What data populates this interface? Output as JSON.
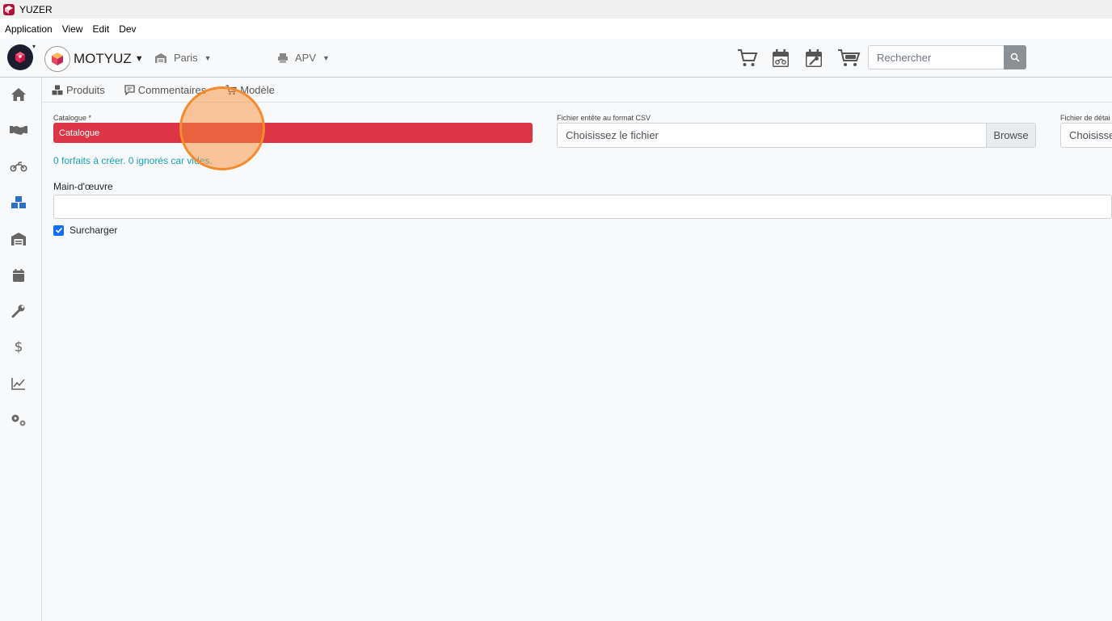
{
  "window": {
    "title": "YUZER"
  },
  "menu": {
    "items": [
      "Application",
      "View",
      "Edit",
      "Dev"
    ]
  },
  "header": {
    "org_name": "MOTYUZ",
    "site": "Paris",
    "department": "APV",
    "search_placeholder": "Rechercher"
  },
  "tabs": [
    {
      "label": "Produits"
    },
    {
      "label": "Commentaires"
    },
    {
      "label": "Modèle"
    }
  ],
  "form": {
    "catalogue_label": "Catalogue *",
    "catalogue_value": "Catalogue",
    "header_file_label": "Fichier entête au format CSV",
    "header_file_placeholder": "Choisissez le fichier",
    "browse_label": "Browse",
    "detail_file_label": "Fichier de détai",
    "detail_file_placeholder": "Choisissez",
    "info_text": "0 forfaits à créer. 0 ignorés car vides.",
    "labour_label": "Main-d'œuvre",
    "labour_value": "",
    "overwrite_label": "Surcharger",
    "overwrite_checked": true
  },
  "colors": {
    "danger": "#dc3545",
    "info": "#17a2b8",
    "primary": "#0d6efd",
    "click_indicator": "#f58a2f"
  },
  "icons": {
    "sidebar": [
      "home-icon",
      "handshake-icon",
      "motorcycle-icon",
      "cubes-icon",
      "warehouse-icon",
      "calendar-icon",
      "wrench-icon",
      "dollar-icon",
      "chart-line-icon",
      "gears-icon"
    ],
    "header": [
      "cart-icon",
      "calendar-moto-icon",
      "calendar-wrench-icon",
      "cart-moto-icon",
      "search-icon"
    ]
  }
}
